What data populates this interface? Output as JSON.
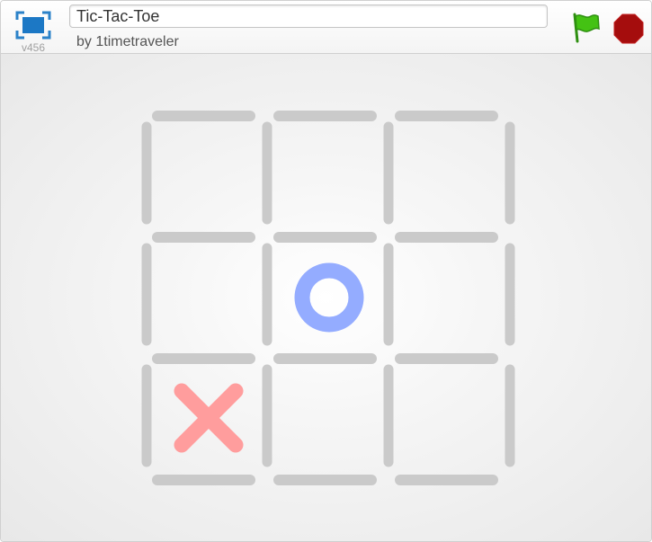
{
  "header": {
    "version": "v456",
    "title": "Tic-Tac-Toe",
    "author": "by 1timetraveler"
  },
  "controls": {
    "flag_icon": "green-flag-icon",
    "stop_icon": "stop-sign-icon",
    "flag_color": "#44c213",
    "stop_color": "#a50d0d"
  },
  "game": {
    "board": [
      [
        "",
        "",
        ""
      ],
      [
        "",
        "O",
        ""
      ],
      [
        "X",
        "",
        ""
      ]
    ],
    "colors": {
      "grid": "#cacaca",
      "x": "#ff9d9d",
      "o": "#94acff"
    }
  }
}
